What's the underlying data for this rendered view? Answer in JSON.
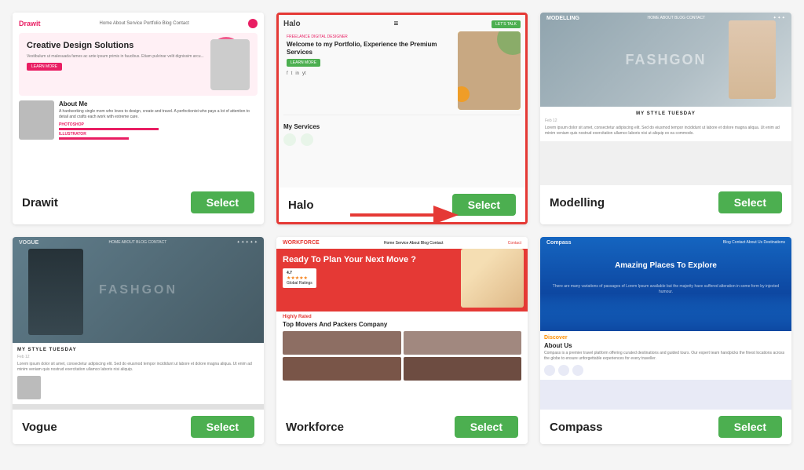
{
  "cards": [
    {
      "id": "drawit",
      "name": "Drawit",
      "select_label": "Select",
      "highlighted": false
    },
    {
      "id": "halo",
      "name": "Halo",
      "select_label": "Select",
      "highlighted": true
    },
    {
      "id": "modelling",
      "name": "Modelling",
      "select_label": "Select",
      "highlighted": false
    },
    {
      "id": "vogue",
      "name": "Vogue",
      "select_label": "Select",
      "highlighted": false
    },
    {
      "id": "workforce",
      "name": "Workforce",
      "select_label": "Select",
      "highlighted": false
    },
    {
      "id": "compass",
      "name": "Compass",
      "select_label": "Select",
      "highlighted": false
    }
  ],
  "drawit": {
    "logo": "Drawit",
    "nav_items": "Home About Service Portfolio Blog Contact",
    "hero_title": "Creative Design Solutions",
    "hero_text": "Vestibulum ut malesuada fames ac ante ipsum primis in faucibus. Etiam pulvinar velit dignissim arcu...",
    "btn_label": "LEARN MORE",
    "about_title": "About Me",
    "about_text": "A hardworking single mom who loves to design, create and travel. A perfectionist who pays a lot of attention to detail and crafts each work with extreme care.",
    "skill1": "PHOTOSHOP",
    "skill2": "ILLUSTRATOR"
  },
  "halo": {
    "logo": "Halo",
    "nav_icon": "≡",
    "cta": "LET'S TALK",
    "subtitle": "FREELANCE DIGITAL DESIGNER",
    "hero_title": "Welcome to my Portfolio, Experience the Premium Services",
    "btn_label": "LEARN MORE",
    "services_title": "My Services"
  },
  "modelling": {
    "logo": "MODELLING",
    "nav_items": "HOME ABOUT BLOG CONTACT",
    "style_title": "MY STYLE TUESDAY",
    "overlay_text": "FASHGON"
  },
  "vogue": {
    "logo": "VOGUE",
    "nav_items": "HOME ABOUT BLOG CONTACT",
    "style_title": "MY STYLE TUESDAY",
    "overlay_text": "FASHGON"
  },
  "workforce": {
    "logo": "WORKFORCE",
    "nav_items": "Home Service About Blog Contact",
    "hero_title": "Ready To Plan Your Next Move ?",
    "rating_value": "4.7",
    "rating_label": "Global Ratings",
    "movers_title": "Top Movers And Packers Company",
    "highly_rated": "Highly Rated"
  },
  "compass": {
    "logo": "Compass",
    "nav_items": "Blog Contact About Us Destinations",
    "hero_title": "Amazing Places To Explore",
    "about_label": "About Us",
    "about_accent": "Discover"
  }
}
